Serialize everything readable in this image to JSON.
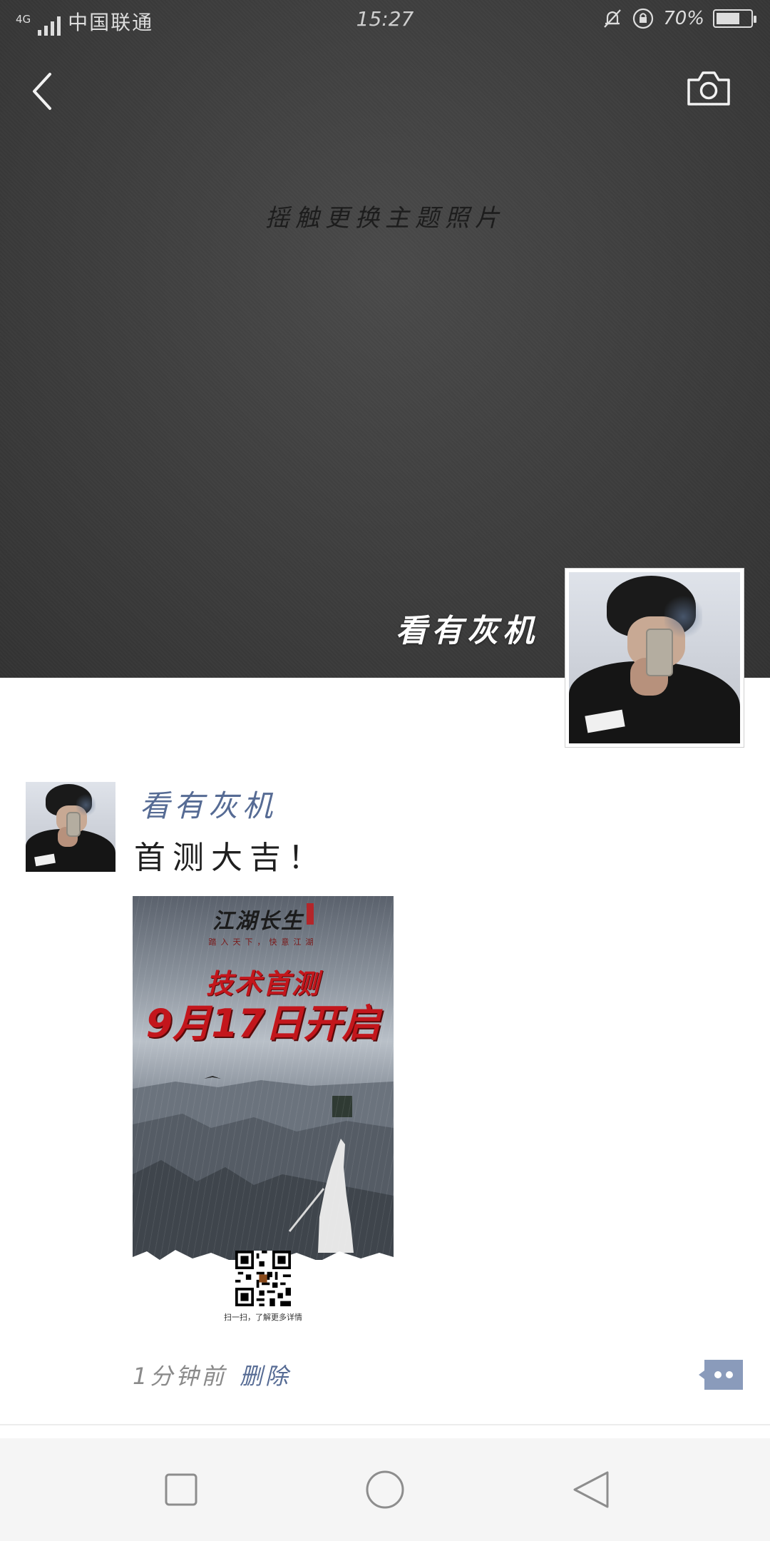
{
  "status_bar": {
    "network_type": "4G",
    "carrier": "中国联通",
    "time": "15:27",
    "battery_percent": "70%",
    "battery_level": 0.7
  },
  "header": {
    "back_icon": "chevron-left-icon",
    "camera_icon": "camera-icon"
  },
  "cover": {
    "hint": "摇触更换主题照片",
    "user_name": "看有灰机"
  },
  "post": {
    "author": "看有灰机",
    "text": "首测大吉！",
    "poster": {
      "logo": "江湖长生",
      "slogan": "踏入天下，快意江湖",
      "headline": "技术首测",
      "date_line": "9月17日开启",
      "qr_caption": "扫一扫，了解更多详情"
    },
    "time": "1分钟前",
    "delete_label": "删除",
    "comment_icon": "comment-more-icon"
  },
  "nav_bar": {
    "recent_icon": "square-icon",
    "home_icon": "circle-icon",
    "back_icon": "triangle-back-icon"
  },
  "colors": {
    "link": "#566b94",
    "cover_bg": "#3f3f3f",
    "comment_button": "#8a9bbb"
  }
}
